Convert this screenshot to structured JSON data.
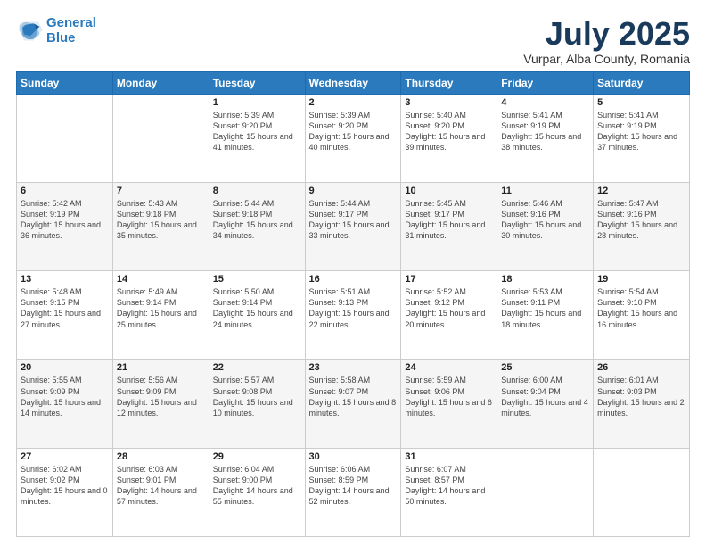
{
  "logo": {
    "line1": "General",
    "line2": "Blue"
  },
  "title": "July 2025",
  "subtitle": "Vurpar, Alba County, Romania",
  "headers": [
    "Sunday",
    "Monday",
    "Tuesday",
    "Wednesday",
    "Thursday",
    "Friday",
    "Saturday"
  ],
  "weeks": [
    [
      {
        "day": "",
        "sunrise": "",
        "sunset": "",
        "daylight": ""
      },
      {
        "day": "",
        "sunrise": "",
        "sunset": "",
        "daylight": ""
      },
      {
        "day": "1",
        "sunrise": "Sunrise: 5:39 AM",
        "sunset": "Sunset: 9:20 PM",
        "daylight": "Daylight: 15 hours and 41 minutes."
      },
      {
        "day": "2",
        "sunrise": "Sunrise: 5:39 AM",
        "sunset": "Sunset: 9:20 PM",
        "daylight": "Daylight: 15 hours and 40 minutes."
      },
      {
        "day": "3",
        "sunrise": "Sunrise: 5:40 AM",
        "sunset": "Sunset: 9:20 PM",
        "daylight": "Daylight: 15 hours and 39 minutes."
      },
      {
        "day": "4",
        "sunrise": "Sunrise: 5:41 AM",
        "sunset": "Sunset: 9:19 PM",
        "daylight": "Daylight: 15 hours and 38 minutes."
      },
      {
        "day": "5",
        "sunrise": "Sunrise: 5:41 AM",
        "sunset": "Sunset: 9:19 PM",
        "daylight": "Daylight: 15 hours and 37 minutes."
      }
    ],
    [
      {
        "day": "6",
        "sunrise": "Sunrise: 5:42 AM",
        "sunset": "Sunset: 9:19 PM",
        "daylight": "Daylight: 15 hours and 36 minutes."
      },
      {
        "day": "7",
        "sunrise": "Sunrise: 5:43 AM",
        "sunset": "Sunset: 9:18 PM",
        "daylight": "Daylight: 15 hours and 35 minutes."
      },
      {
        "day": "8",
        "sunrise": "Sunrise: 5:44 AM",
        "sunset": "Sunset: 9:18 PM",
        "daylight": "Daylight: 15 hours and 34 minutes."
      },
      {
        "day": "9",
        "sunrise": "Sunrise: 5:44 AM",
        "sunset": "Sunset: 9:17 PM",
        "daylight": "Daylight: 15 hours and 33 minutes."
      },
      {
        "day": "10",
        "sunrise": "Sunrise: 5:45 AM",
        "sunset": "Sunset: 9:17 PM",
        "daylight": "Daylight: 15 hours and 31 minutes."
      },
      {
        "day": "11",
        "sunrise": "Sunrise: 5:46 AM",
        "sunset": "Sunset: 9:16 PM",
        "daylight": "Daylight: 15 hours and 30 minutes."
      },
      {
        "day": "12",
        "sunrise": "Sunrise: 5:47 AM",
        "sunset": "Sunset: 9:16 PM",
        "daylight": "Daylight: 15 hours and 28 minutes."
      }
    ],
    [
      {
        "day": "13",
        "sunrise": "Sunrise: 5:48 AM",
        "sunset": "Sunset: 9:15 PM",
        "daylight": "Daylight: 15 hours and 27 minutes."
      },
      {
        "day": "14",
        "sunrise": "Sunrise: 5:49 AM",
        "sunset": "Sunset: 9:14 PM",
        "daylight": "Daylight: 15 hours and 25 minutes."
      },
      {
        "day": "15",
        "sunrise": "Sunrise: 5:50 AM",
        "sunset": "Sunset: 9:14 PM",
        "daylight": "Daylight: 15 hours and 24 minutes."
      },
      {
        "day": "16",
        "sunrise": "Sunrise: 5:51 AM",
        "sunset": "Sunset: 9:13 PM",
        "daylight": "Daylight: 15 hours and 22 minutes."
      },
      {
        "day": "17",
        "sunrise": "Sunrise: 5:52 AM",
        "sunset": "Sunset: 9:12 PM",
        "daylight": "Daylight: 15 hours and 20 minutes."
      },
      {
        "day": "18",
        "sunrise": "Sunrise: 5:53 AM",
        "sunset": "Sunset: 9:11 PM",
        "daylight": "Daylight: 15 hours and 18 minutes."
      },
      {
        "day": "19",
        "sunrise": "Sunrise: 5:54 AM",
        "sunset": "Sunset: 9:10 PM",
        "daylight": "Daylight: 15 hours and 16 minutes."
      }
    ],
    [
      {
        "day": "20",
        "sunrise": "Sunrise: 5:55 AM",
        "sunset": "Sunset: 9:09 PM",
        "daylight": "Daylight: 15 hours and 14 minutes."
      },
      {
        "day": "21",
        "sunrise": "Sunrise: 5:56 AM",
        "sunset": "Sunset: 9:09 PM",
        "daylight": "Daylight: 15 hours and 12 minutes."
      },
      {
        "day": "22",
        "sunrise": "Sunrise: 5:57 AM",
        "sunset": "Sunset: 9:08 PM",
        "daylight": "Daylight: 15 hours and 10 minutes."
      },
      {
        "day": "23",
        "sunrise": "Sunrise: 5:58 AM",
        "sunset": "Sunset: 9:07 PM",
        "daylight": "Daylight: 15 hours and 8 minutes."
      },
      {
        "day": "24",
        "sunrise": "Sunrise: 5:59 AM",
        "sunset": "Sunset: 9:06 PM",
        "daylight": "Daylight: 15 hours and 6 minutes."
      },
      {
        "day": "25",
        "sunrise": "Sunrise: 6:00 AM",
        "sunset": "Sunset: 9:04 PM",
        "daylight": "Daylight: 15 hours and 4 minutes."
      },
      {
        "day": "26",
        "sunrise": "Sunrise: 6:01 AM",
        "sunset": "Sunset: 9:03 PM",
        "daylight": "Daylight: 15 hours and 2 minutes."
      }
    ],
    [
      {
        "day": "27",
        "sunrise": "Sunrise: 6:02 AM",
        "sunset": "Sunset: 9:02 PM",
        "daylight": "Daylight: 15 hours and 0 minutes."
      },
      {
        "day": "28",
        "sunrise": "Sunrise: 6:03 AM",
        "sunset": "Sunset: 9:01 PM",
        "daylight": "Daylight: 14 hours and 57 minutes."
      },
      {
        "day": "29",
        "sunrise": "Sunrise: 6:04 AM",
        "sunset": "Sunset: 9:00 PM",
        "daylight": "Daylight: 14 hours and 55 minutes."
      },
      {
        "day": "30",
        "sunrise": "Sunrise: 6:06 AM",
        "sunset": "Sunset: 8:59 PM",
        "daylight": "Daylight: 14 hours and 52 minutes."
      },
      {
        "day": "31",
        "sunrise": "Sunrise: 6:07 AM",
        "sunset": "Sunset: 8:57 PM",
        "daylight": "Daylight: 14 hours and 50 minutes."
      },
      {
        "day": "",
        "sunrise": "",
        "sunset": "",
        "daylight": ""
      },
      {
        "day": "",
        "sunrise": "",
        "sunset": "",
        "daylight": ""
      }
    ]
  ]
}
